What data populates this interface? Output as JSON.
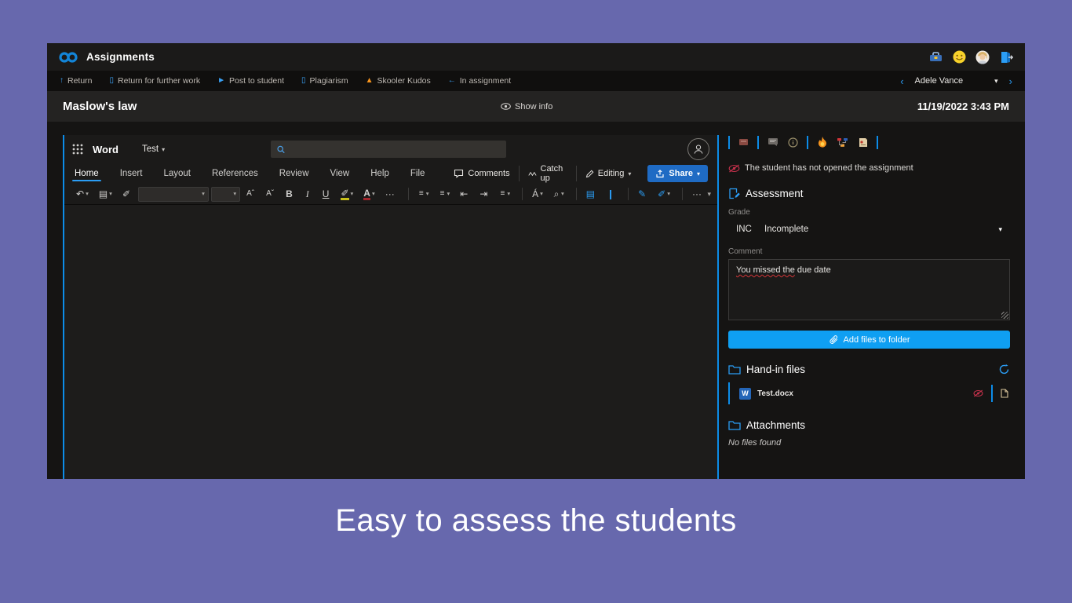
{
  "caption": "Easy to assess the students",
  "titlebar": {
    "app": "Assignments",
    "icons": [
      "toolbox-icon",
      "reaction-smiley-icon",
      "user-avatar",
      "sign-out-icon"
    ]
  },
  "commandbar": {
    "items": [
      {
        "name": "cmd-in-assignment",
        "icon": "←",
        "iconcls": "ic-blue",
        "label": "In assignment"
      },
      {
        "name": "cmd-return",
        "icon": "↑",
        "iconcls": "ic-blue",
        "label": "Return"
      },
      {
        "name": "cmd-return-further-work",
        "icon": "▯",
        "iconcls": "ic-blue",
        "label": "Return for further work"
      },
      {
        "name": "cmd-post-to-student",
        "icon": "►",
        "iconcls": "ic-blue",
        "label": "Post to student"
      },
      {
        "name": "cmd-plagiarism",
        "icon": "▯",
        "iconcls": "ic-blue",
        "label": "Plagiarism"
      },
      {
        "name": "cmd-skooler-kudos",
        "icon": "▲",
        "iconcls": "ic-orange",
        "label": "Skooler Kudos"
      }
    ],
    "prev": "‹",
    "next": "›",
    "student": "Adele Vance",
    "caret": "▾"
  },
  "header": {
    "title": "Maslow's law",
    "show_info": "Show info",
    "datetime": "11/19/2022 3:43 PM"
  },
  "word": {
    "app_name": "Word",
    "doc_name": "Test",
    "doc_caret": "▾",
    "tabs": [
      {
        "name": "tab-file",
        "label": "File",
        "cls": ""
      },
      {
        "name": "tab-home",
        "label": "Home",
        "cls": "active"
      },
      {
        "name": "tab-insert",
        "label": "Insert",
        "cls": ""
      },
      {
        "name": "tab-layout",
        "label": "Layout",
        "cls": ""
      },
      {
        "name": "tab-references",
        "label": "References",
        "cls": ""
      },
      {
        "name": "tab-review",
        "label": "Review",
        "cls": ""
      },
      {
        "name": "tab-view",
        "label": "View",
        "cls": ""
      },
      {
        "name": "tab-help",
        "label": "Help",
        "cls": ""
      }
    ],
    "actions": {
      "comments": "Comments",
      "catch_up": "Catch up",
      "editing": "Editing",
      "editing_caret": "▾",
      "share": "Share",
      "share_caret": "▾"
    },
    "ribbon": [
      {
        "name": "undo-button",
        "t": "↶",
        "caret": "▾",
        "cls": ""
      },
      {
        "name": "paste-button",
        "t": "▤",
        "caret": "▾",
        "cls": ""
      },
      {
        "name": "format-painter-button",
        "t": "✐",
        "caret": "",
        "cls": ""
      },
      {
        "name": "font-name-select",
        "t": "",
        "caret": "▾",
        "cls": "selbox"
      },
      {
        "name": "font-size-select",
        "t": "",
        "caret": "▾",
        "cls": "selbox sm"
      },
      {
        "name": "grow-font-button",
        "t": "Aˆ",
        "caret": "",
        "cls": "small"
      },
      {
        "name": "shrink-font-button",
        "t": "Aˇ",
        "caret": "",
        "cls": "small"
      },
      {
        "name": "bold-button",
        "t": "B",
        "caret": "",
        "cls": "b"
      },
      {
        "name": "italic-button",
        "t": "I",
        "caret": "",
        "cls": "i"
      },
      {
        "name": "underline-button",
        "t": "U",
        "caret": "",
        "cls": "u"
      },
      {
        "name": "highlight-color-button",
        "t": "✐",
        "caret": "▾",
        "cls": "hl"
      },
      {
        "name": "font-color-button",
        "t": "A",
        "caret": "▾",
        "cls": "fc"
      },
      {
        "name": "more-font-options-button",
        "t": "···",
        "caret": "",
        "cls": ""
      },
      {
        "name": "ribbon-separator",
        "t": "",
        "caret": "",
        "cls": "sep"
      },
      {
        "name": "bullets-button",
        "t": "≡",
        "caret": "▾",
        "cls": "small"
      },
      {
        "name": "numbering-button",
        "t": "≡",
        "caret": "▾",
        "cls": "small"
      },
      {
        "name": "outdent-button",
        "t": "⇤",
        "caret": "",
        "cls": ""
      },
      {
        "name": "indent-button",
        "t": "⇥",
        "caret": "",
        "cls": ""
      },
      {
        "name": "alignment-button",
        "t": "≡",
        "caret": "▾",
        "cls": "small"
      },
      {
        "name": "ribbon-separator",
        "t": "",
        "caret": "",
        "cls": "sep"
      },
      {
        "name": "styles-button",
        "t": "Á",
        "caret": "▾",
        "cls": ""
      },
      {
        "name": "find-button",
        "t": "⌕",
        "caret": "▾",
        "cls": ""
      },
      {
        "name": "ribbon-separator",
        "t": "",
        "caret": "",
        "cls": "sep"
      },
      {
        "name": "immersive-reader-button",
        "t": "▤",
        "caret": "",
        "cls": "blue"
      },
      {
        "name": "dictate-button",
        "t": "❙",
        "caret": "",
        "cls": "blue"
      },
      {
        "name": "ribbon-separator",
        "t": "",
        "caret": "",
        "cls": "sep"
      },
      {
        "name": "editor-button",
        "t": "✎",
        "caret": "",
        "cls": "blue"
      },
      {
        "name": "designer-button",
        "t": "✐",
        "caret": "▾",
        "cls": "blue"
      },
      {
        "name": "ribbon-separator",
        "t": "",
        "caret": "",
        "cls": "sep"
      },
      {
        "name": "ribbon-overflow-button",
        "t": "···",
        "caret": "",
        "cls": ""
      }
    ],
    "ribbon_collapse": "▾"
  },
  "panel": {
    "toolbar_icons": [
      "grade-book-icon",
      "feedback-card-icon",
      "info-icon",
      "kudos-flame-icon",
      "learning-plan-icon",
      "notes-icon"
    ],
    "status": "The student has not opened the assignment",
    "assessment": {
      "title": "Assessment",
      "grade_label": "Grade",
      "grade_code": "INC",
      "grade_text": "Incomplete",
      "grade_caret": "▾",
      "comment_label": "Comment",
      "comment_underlined": "You missed the",
      "comment_rest": " due date",
      "add_files": "Add files to folder"
    },
    "handin": {
      "title": "Hand-in files",
      "file": "Test.docx"
    },
    "attachments": {
      "title": "Attachments",
      "empty": "No files found"
    }
  }
}
